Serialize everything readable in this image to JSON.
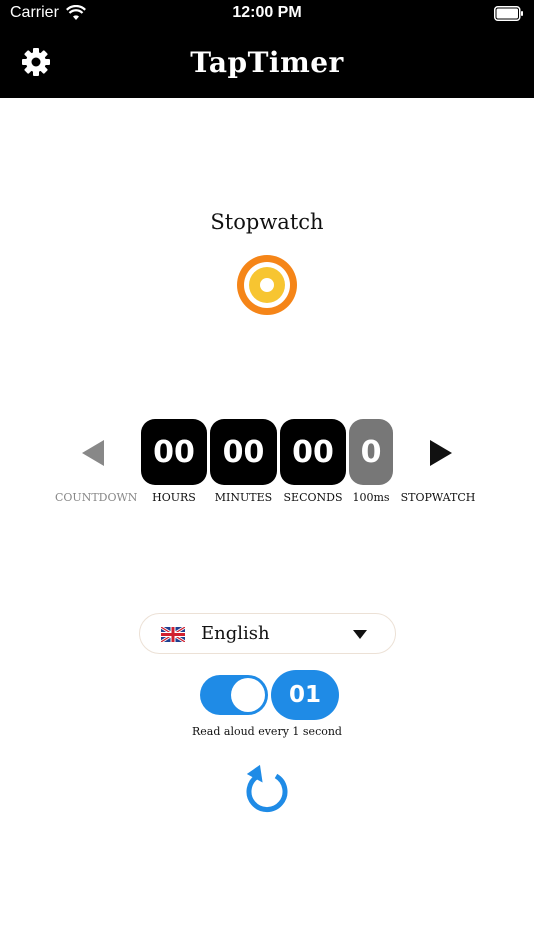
{
  "status_bar": {
    "carrier": "Carrier",
    "time": "12:00 PM"
  },
  "header": {
    "title": "TapTimer",
    "settings_icon": "gear-icon"
  },
  "mode": {
    "title": "Stopwatch",
    "icon": "target-icon",
    "colors": {
      "outer": "#f58518",
      "inner": "#f7c531"
    }
  },
  "timer": {
    "hours": "00",
    "minutes": "00",
    "seconds": "00",
    "ms": "0",
    "labels": {
      "countdown": "COUNTDOWN",
      "hours": "HOURS",
      "minutes": "MINUTES",
      "seconds": "SECONDS",
      "ms": "100ms",
      "stopwatch": "STOPWATCH"
    }
  },
  "language": {
    "selected": "English",
    "flag": "uk-flag-icon"
  },
  "read_aloud": {
    "enabled": true,
    "interval": "01",
    "label": "Read aloud every 1 second",
    "accent": "#1f8be6"
  },
  "reset": {
    "icon": "reset-icon"
  }
}
